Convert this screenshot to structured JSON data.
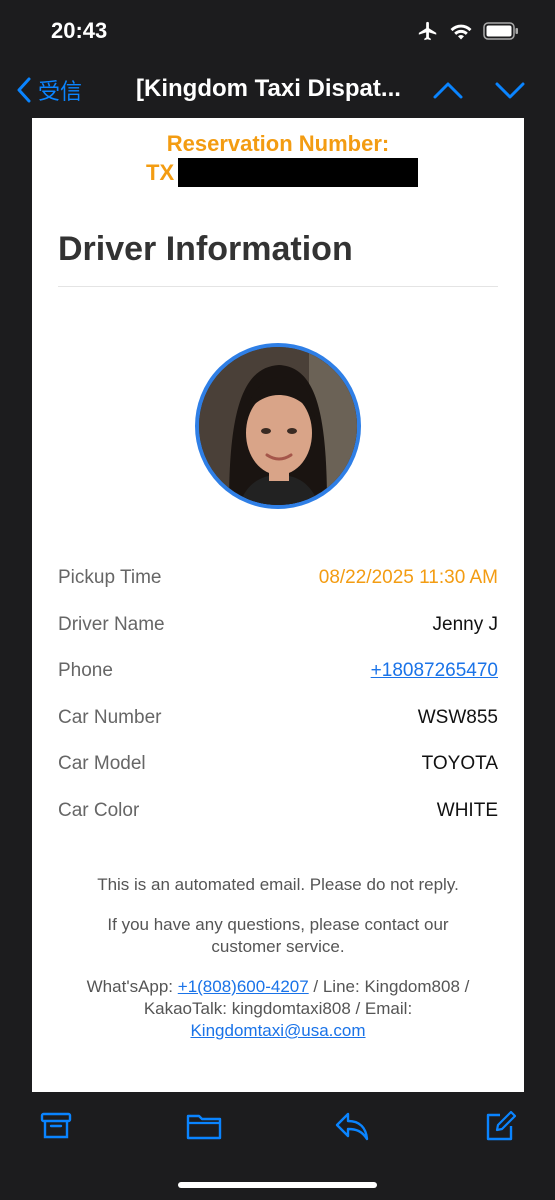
{
  "status": {
    "time": "20:43"
  },
  "nav": {
    "back_label": "受信",
    "title": "[Kingdom Taxi Dispat..."
  },
  "email": {
    "reservation_label": "Reservation Number:",
    "reservation_prefix": "TX",
    "heading": "Driver Information",
    "rows": [
      {
        "label": "Pickup Time",
        "value": "08/22/2025 11:30 AM"
      },
      {
        "label": "Driver Name",
        "value": "Jenny J"
      },
      {
        "label": "Phone",
        "value": "+18087265470"
      },
      {
        "label": "Car Number",
        "value": "WSW855"
      },
      {
        "label": "Car Model",
        "value": "TOYOTA"
      },
      {
        "label": "Car Color",
        "value": "WHITE"
      }
    ],
    "footer": {
      "automated": "This is an automated email. Please do not reply.",
      "questions": "If you have any questions, please contact our customer service.",
      "contact_prefix": "What'sApp: ",
      "whatsapp": "+1(808)600-4207",
      "contact_mid": " / Line: Kingdom808 / KakaoTalk: kingdomtaxi808 / Email: ",
      "email": "Kingdomtaxi@usa.com"
    }
  },
  "colors": {
    "accent": "#0a84ff",
    "highlight": "#f39c12",
    "link": "#1a73e8"
  },
  "toolbar": {
    "icons": [
      "archive-icon",
      "folder-icon",
      "reply-icon",
      "compose-icon"
    ]
  }
}
